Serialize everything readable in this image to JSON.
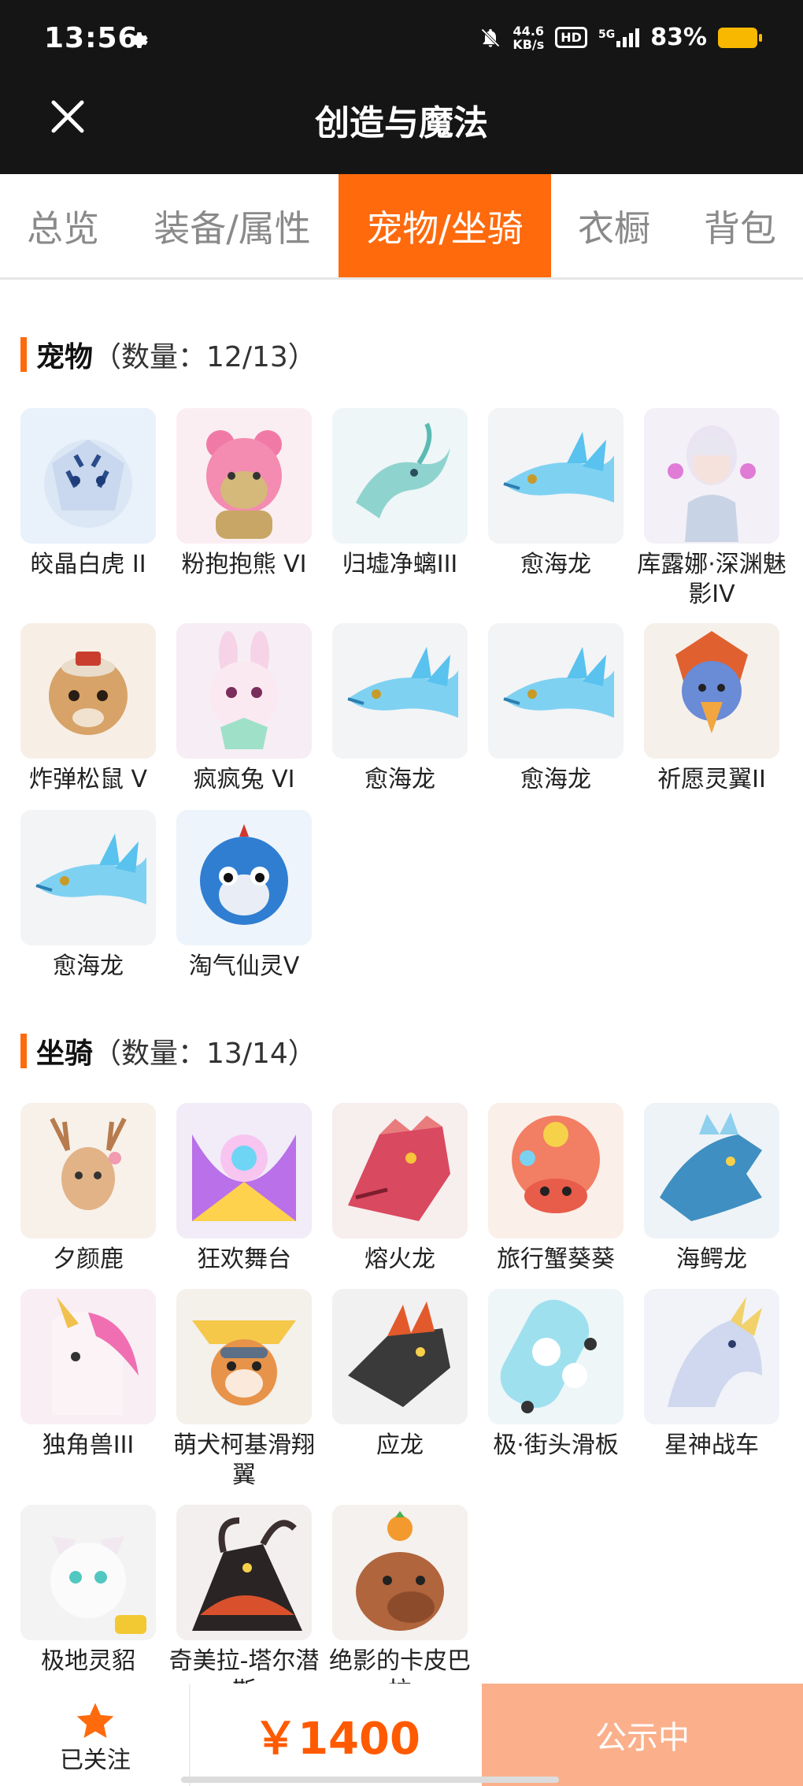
{
  "status_bar": {
    "time": "13:56",
    "speed_value": "44.6",
    "speed_unit": "KB/s",
    "hd": "HD",
    "network": "5G",
    "battery": "83%"
  },
  "header": {
    "title": "创造与魔法"
  },
  "tabs": [
    {
      "label": "总览"
    },
    {
      "label": "装备/属性"
    },
    {
      "label": "宠物/坐骑",
      "active": true
    },
    {
      "label": "衣橱"
    },
    {
      "label": "背包"
    }
  ],
  "pets": {
    "name": "宠物",
    "count": "（数量：12/13）",
    "items": [
      {
        "name": "皎晶白虎 II",
        "icon": "white-tiger-icon"
      },
      {
        "name": "粉抱抱熊 VI",
        "icon": "pink-bear-icon"
      },
      {
        "name": "归墟净螭III",
        "icon": "jade-dragon-icon"
      },
      {
        "name": "愈海龙",
        "icon": "sea-dragon-icon"
      },
      {
        "name": "库露娜·深渊魅影IV",
        "icon": "kuluna-icon"
      },
      {
        "name": "炸弹松鼠 V",
        "icon": "bomb-squirrel-icon"
      },
      {
        "name": "疯疯兔 VI",
        "icon": "crazy-rabbit-icon"
      },
      {
        "name": "愈海龙",
        "icon": "sea-dragon-icon"
      },
      {
        "name": "愈海龙",
        "icon": "sea-dragon-icon"
      },
      {
        "name": "祈愿灵翼II",
        "icon": "wish-bird-icon"
      },
      {
        "name": "愈海龙",
        "icon": "sea-dragon-icon"
      },
      {
        "name": "淘气仙灵V",
        "icon": "naughty-spirit-icon"
      }
    ]
  },
  "mounts": {
    "name": "坐骑",
    "count": "（数量：13/14）",
    "items": [
      {
        "name": "夕颜鹿",
        "icon": "deer-icon"
      },
      {
        "name": "狂欢舞台",
        "icon": "carnival-stage-icon"
      },
      {
        "name": "熔火龙",
        "icon": "magma-dragon-icon"
      },
      {
        "name": "旅行蟹葵葵",
        "icon": "hermit-crab-icon"
      },
      {
        "name": "海鳄龙",
        "icon": "sea-croc-dragon-icon"
      },
      {
        "name": "独角兽III",
        "icon": "unicorn-icon"
      },
      {
        "name": "萌犬柯基滑翔翼",
        "icon": "corgi-glider-icon"
      },
      {
        "name": "应龙",
        "icon": "ying-dragon-icon"
      },
      {
        "name": "极·街头滑板",
        "icon": "skateboard-icon"
      },
      {
        "name": "星神战车",
        "icon": "star-chariot-icon"
      },
      {
        "name": "极地灵貂",
        "icon": "polar-marten-icon"
      },
      {
        "name": "奇美拉-塔尔潜斯",
        "icon": "chimera-icon"
      },
      {
        "name": "绝影的卡皮巴拉",
        "icon": "capybara-icon"
      }
    ]
  },
  "bottom_bar": {
    "follow_label": "已关注",
    "price": "￥1400",
    "status_button": "公示中"
  },
  "colors": {
    "accent": "#ff6a0d",
    "price": "#ff5a00",
    "status_button": "#fbb08b",
    "header_bg": "#151515"
  }
}
